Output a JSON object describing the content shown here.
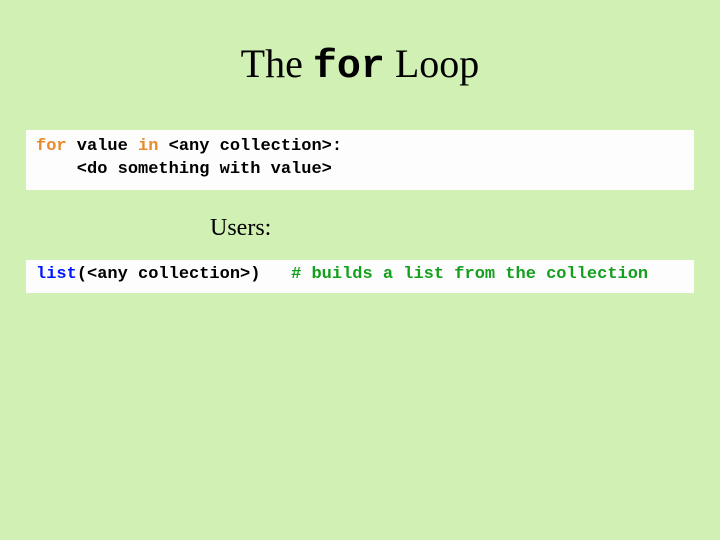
{
  "title": {
    "part1": "The ",
    "part2": "for",
    "part3": " Loop"
  },
  "code1": {
    "kw_for": "for",
    "s1": " value ",
    "kw_in": "in",
    "s2": " <any collection>:",
    "line2": "    <do something with value>"
  },
  "users_label": "Users:",
  "code2": {
    "kw_list": "list",
    "s1": "(<any collection>)   ",
    "comment": "# builds a list from the collection"
  }
}
